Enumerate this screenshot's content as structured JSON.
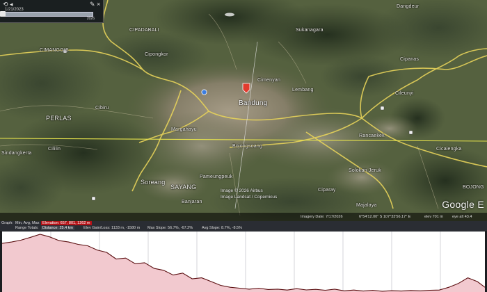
{
  "time_slider": {
    "date": "1/21/2023",
    "end_year": "2026"
  },
  "map_labels": [
    {
      "name": "cipadabali-label",
      "text": "CIPADABALI"
    },
    {
      "name": "sukanagara-label",
      "text": "Sukanagara"
    },
    {
      "name": "cimanggis-label",
      "text": "CIMANGGIS"
    },
    {
      "name": "bandung-label",
      "text": "Bandung"
    },
    {
      "name": "cimenyan-label",
      "text": "Cimenyan"
    },
    {
      "name": "perlas-label",
      "text": "PERLAS"
    },
    {
      "name": "cibiru-label",
      "text": "Cibiru"
    },
    {
      "name": "sindangkerta-label",
      "text": "Sindangkerta"
    },
    {
      "name": "cililin-label",
      "text": "Cililin"
    },
    {
      "name": "margahayu-label",
      "text": "Margahayu"
    },
    {
      "name": "soreang-label",
      "text": "Soreang"
    },
    {
      "name": "sayang-label",
      "text": "SAYANG"
    },
    {
      "name": "pameungpeuk-label",
      "text": "Pameungpeuk"
    },
    {
      "name": "banjaran-label",
      "text": "Banjaran"
    },
    {
      "name": "bojongsoang-label",
      "text": "Bojongsoang"
    },
    {
      "name": "rancaekek-label",
      "text": "Rancaekek"
    },
    {
      "name": "solokan-jeruk-label",
      "text": "Solokan Jeruk"
    },
    {
      "name": "ciparay-label",
      "text": "Ciparay"
    },
    {
      "name": "majalaya-label",
      "text": "Majalaya"
    },
    {
      "name": "cicalengka-label",
      "text": "Cicalengka"
    },
    {
      "name": "bojong-label",
      "text": "BOJONG"
    },
    {
      "name": "cileunyi-label",
      "text": "Cileunyi"
    },
    {
      "name": "dangdeur-label",
      "text": "Dangdeur"
    },
    {
      "name": "cipanas-label",
      "text": "Cipanas"
    },
    {
      "name": "cipongkor-label",
      "text": "Cipongkor"
    },
    {
      "name": "lembang-label",
      "text": "Lembang"
    }
  ],
  "copyright": {
    "line1": "Image © 2026 Airbus",
    "line2": "Image Landsat / Copernicus"
  },
  "google_mark": "Google E",
  "status_bar": {
    "imagery_date": "Imagery Date: 7/17/2026",
    "coords": "6°54'12.00\" S  107°33'56.17\" E",
    "elev": "elev  701 m",
    "eye_alt": "eye alt  43.4"
  },
  "profile_header": {
    "graph": "Graph:",
    "min_avg_max": "Min, Avg, Max",
    "elevation": "Elevation: 657, 801, 1262 m",
    "range_totals": "Range Totals:",
    "distance": "Distance: 25.4 km",
    "elev_gain_loss": "Elev Gain/Loss: 1133 m, -1580 m",
    "max_slope": "Max Slope: 56.7%, -67.2%",
    "avg_slope": "Avg Slope: 8.7%, -8.5%"
  },
  "colors": {
    "profile_fill": "#f2c9cf",
    "profile_line": "#5a0e10",
    "path_line": "#e8e44c",
    "road": "#e7d35a",
    "marker": "#e23b2e"
  },
  "chart_data": {
    "type": "area",
    "x": [
      0,
      0.5,
      1,
      1.5,
      2,
      2.5,
      3,
      3.5,
      4,
      4.5,
      5,
      5.5,
      6,
      6.5,
      7,
      7.5,
      8,
      8.5,
      9,
      9.5,
      10,
      10.5,
      11,
      11.5,
      12,
      12.5,
      13,
      13.5,
      14,
      14.5,
      15,
      15.5,
      16,
      16.5,
      17,
      17.5,
      18,
      18.5,
      19,
      19.5,
      20,
      20.5,
      21,
      21.5,
      22,
      22.5,
      23,
      23.5,
      24,
      24.5,
      25,
      25.4
    ],
    "y": [
      1165,
      1180,
      1200,
      1230,
      1262,
      1235,
      1195,
      1180,
      1155,
      1140,
      1095,
      1070,
      1000,
      1010,
      950,
      960,
      900,
      880,
      830,
      850,
      790,
      800,
      760,
      720,
      700,
      690,
      680,
      690,
      676,
      680,
      670,
      685,
      672,
      678,
      668,
      680,
      662,
      670,
      660,
      668,
      658,
      664,
      660,
      666,
      662,
      668,
      670,
      700,
      740,
      800,
      760,
      700
    ],
    "ylim": [
      657,
      1262
    ]
  }
}
